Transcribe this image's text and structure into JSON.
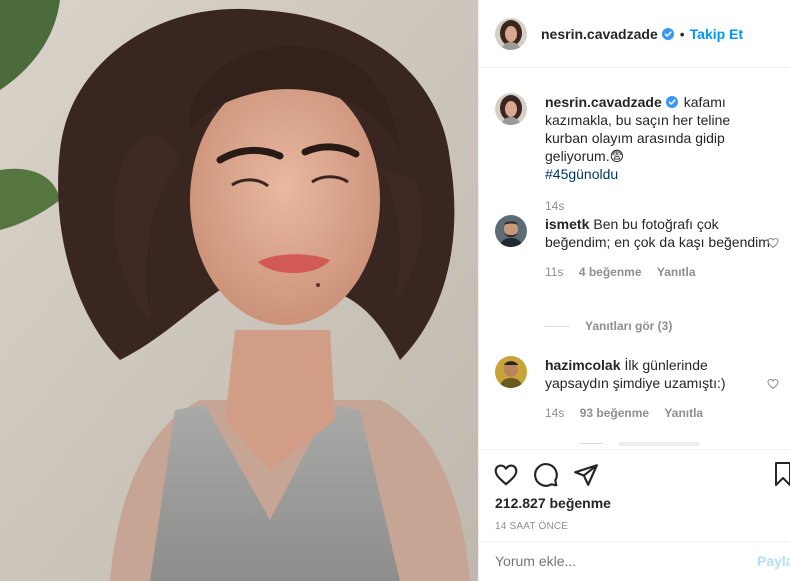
{
  "header": {
    "username": "nesrin.cavadzade",
    "separator": "•",
    "follow_label": "Takip Et"
  },
  "caption": {
    "username": "nesrin.cavadzade",
    "text": "kafamı kazımakla, bu saçın her teline kurban olayım arasında gidip geliyorum.😨",
    "hashtag": "#45günoldu",
    "time": "14s"
  },
  "comments": [
    {
      "username": "ismetk",
      "text": "Ben bu fotoğrafı çok beğendim; en çok da kaşı beğendim",
      "time": "11s",
      "likes": "4 beğenme",
      "reply": "Yanıtla",
      "view_replies": "Yanıtları gör (3)"
    },
    {
      "username": "hazimcolak",
      "text": "İlk günlerinde yapsaydın şimdiye uzamıştı:)",
      "time": "14s",
      "likes": "93 beğenme",
      "reply": "Yanıtla"
    }
  ],
  "actions": {
    "likes": "212.827 beğenme",
    "posted": "14 SAAT ÖNCE"
  },
  "add_comment": {
    "placeholder": "Yorum ekle...",
    "post_label": "Payla"
  },
  "colors": {
    "link_blue": "#0095f6",
    "text": "#262626",
    "muted": "#8e8e8e",
    "divider": "#efefef",
    "hashtag": "#00376b",
    "post_disabled": "#b2dffc"
  }
}
